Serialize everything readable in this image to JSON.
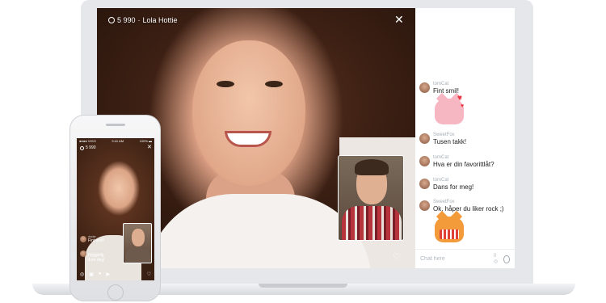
{
  "video": {
    "coin_count": "5 990",
    "separator": "·",
    "host_name": "Lola Hottie",
    "close_label": "✕",
    "like_label": "♡"
  },
  "chat": {
    "messages": [
      {
        "user": "tomCat",
        "text": "Fint smil!"
      },
      {
        "user": "SweetFox",
        "text": "Tusen takk!"
      },
      {
        "user": "tomCat",
        "text": "Hva er din favorittlåt?"
      },
      {
        "user": "tomCat",
        "text": "Dans for meg!"
      },
      {
        "user": "SweetFox",
        "text": "Ok, håper du liker rock ;)"
      }
    ],
    "input_placeholder": "Chat here",
    "coin_indicator": "0 ◎"
  },
  "phone": {
    "status_left": "●●●● VIGO",
    "status_time": "9:41 AM",
    "status_battery": "100% ▬",
    "coin_count": "5 990",
    "close_label": "✕",
    "messages": [
      {
        "user": "doctor",
        "text": "Fint smil!"
      },
      {
        "user": "paradewgirl",
        "text": "Hyggelig"
      },
      {
        "user": "",
        "text": "å se deg!"
      }
    ],
    "toolbar_icons": [
      "◎",
      "▣",
      "●",
      "▶",
      "♡"
    ]
  },
  "colors": {
    "laptop_frame": "#e6e7ea",
    "heart_red": "#e8333f",
    "chat_username": "#a8b0b8"
  },
  "icons": {
    "close": "close-icon",
    "heart": "heart-icon",
    "coin": "coin-icon",
    "emoji": "emoji-icon"
  }
}
